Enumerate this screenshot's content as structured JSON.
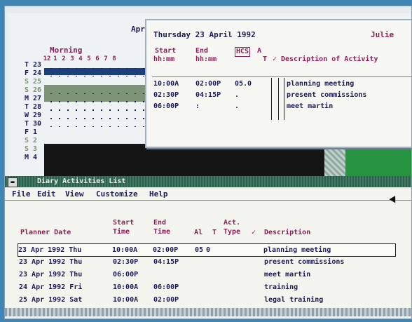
{
  "planner": {
    "month_label": "Apr",
    "period_label": "Morning",
    "hours": [
      "12",
      "1",
      "2",
      "3",
      "4",
      "5",
      "6",
      "7",
      "8"
    ],
    "days": [
      {
        "dow": "T",
        "date": "23"
      },
      {
        "dow": "F",
        "date": "24"
      },
      {
        "dow": "S",
        "date": "25"
      },
      {
        "dow": "S",
        "date": "26"
      },
      {
        "dow": "M",
        "date": "27"
      },
      {
        "dow": "T",
        "date": "28"
      },
      {
        "dow": "W",
        "date": "29"
      },
      {
        "dow": "T",
        "date": "30"
      },
      {
        "dow": "F",
        "date": "1"
      },
      {
        "dow": "S",
        "date": "2"
      },
      {
        "dow": "S",
        "date": "3"
      },
      {
        "dow": "M",
        "date": "4"
      }
    ]
  },
  "detail": {
    "title": "Thursday 23 April 1992",
    "user": "Julie",
    "headers": {
      "start": "Start",
      "start_fmt": "hh:mm",
      "end": "End",
      "end_fmt": "hh:mm",
      "hcs": "HCS",
      "a": "A",
      "alarm_t": "T",
      "description": "Description of Activity"
    },
    "rows": [
      {
        "start": "10:00A",
        "end": "02:00P",
        "hcs": "05.0",
        "desc": "planning meeting"
      },
      {
        "start": "02:30P",
        "end": "04:15P",
        "hcs": ".",
        "desc": "present commissions"
      },
      {
        "start": "06:00P",
        "end": ":",
        "hcs": ".",
        "desc": "meet martin"
      }
    ]
  },
  "list": {
    "title": "Diary Activities List",
    "menu": [
      "File",
      "Edit",
      "View",
      "Customize",
      "Help"
    ],
    "headers": {
      "planner_date": "Planner Date",
      "start_time": "Start\nTime",
      "end_time": "End\nTime",
      "al": "Al",
      "t": "T",
      "act_type": "Act.\nType",
      "description": "Description"
    },
    "rows": [
      {
        "date": "23 Apr 1992 Thu",
        "start": "10:00A",
        "end": "02:00P",
        "al": "05",
        "t": "0",
        "desc": "planning meeting"
      },
      {
        "date": "23 Apr 1992 Thu",
        "start": "02:30P",
        "end": "04:15P",
        "al": "",
        "t": "",
        "desc": "present commissions"
      },
      {
        "date": "23 Apr 1992 Thu",
        "start": "06:00P",
        "end": "",
        "al": "",
        "t": "",
        "desc": "meet martin"
      },
      {
        "date": "24 Apr 1992 Fri",
        "start": "10:00A",
        "end": "06:00P",
        "al": "",
        "t": "",
        "desc": "training"
      },
      {
        "date": "25 Apr 1992 Sat",
        "start": "10:00A",
        "end": "02:00P",
        "al": "",
        "t": "",
        "desc": "legal training"
      }
    ]
  }
}
